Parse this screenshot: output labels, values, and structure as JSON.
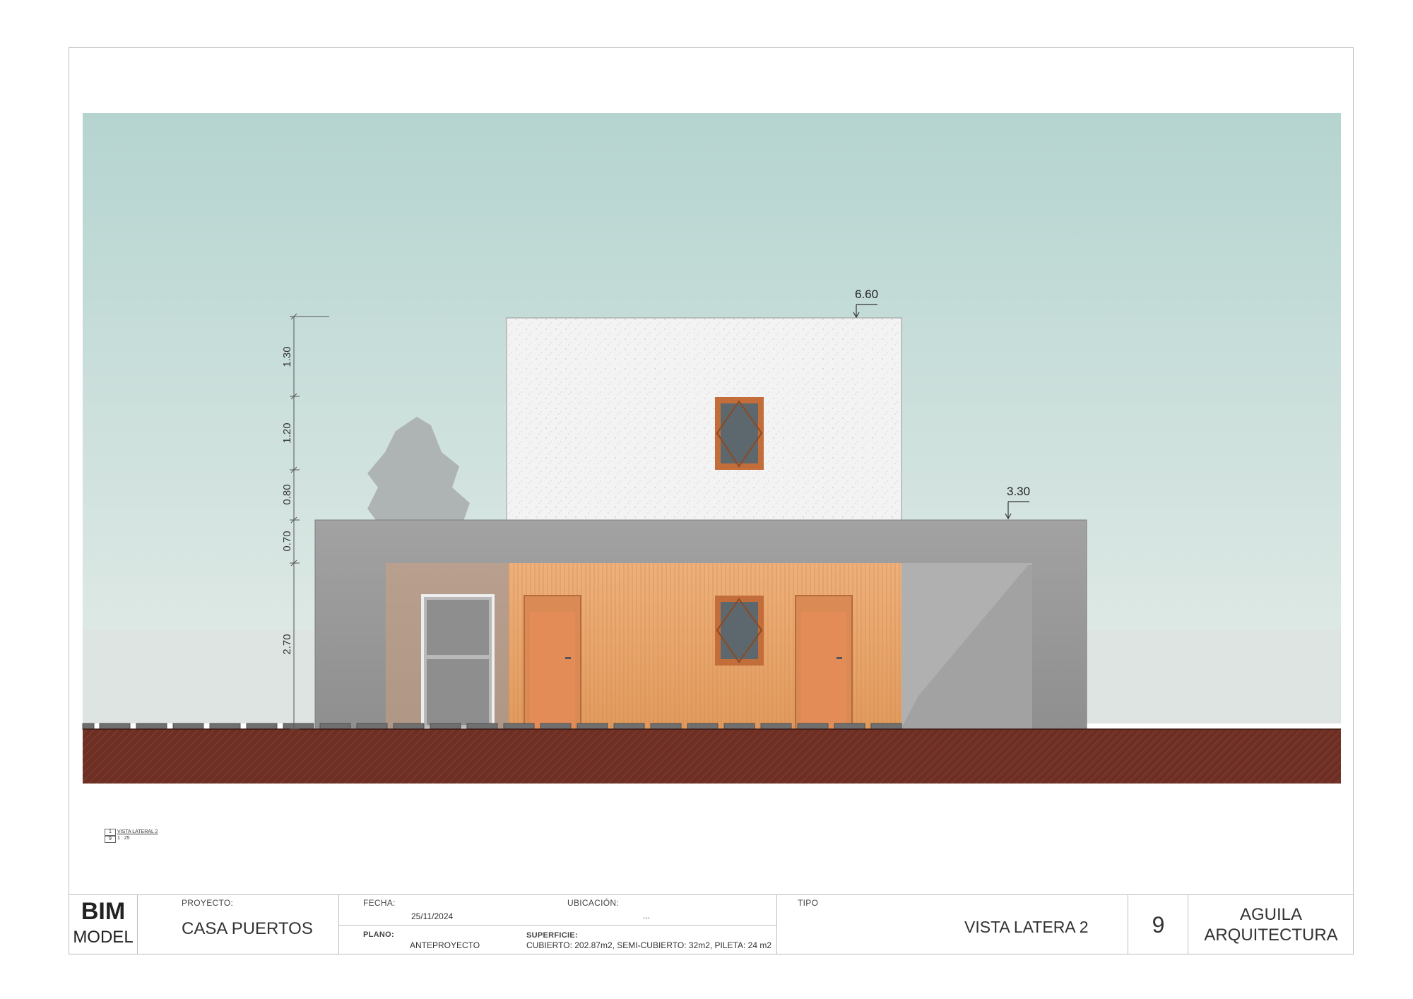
{
  "drawing": {
    "dimensions_vertical": [
      "1.30",
      "1.20",
      "0.80",
      "0.70",
      "2.70"
    ],
    "level_upper": "6.60",
    "level_lower": "3.30",
    "colors": {
      "sky_top": "#b7d5d1",
      "sky_bottom": "#e2ebe7",
      "ground": "#6b2d22",
      "concrete": "#9d9d9d",
      "wood_cladding": "#e9a66d",
      "stucco": "#f2f2f2",
      "window_frame": "#c7713a",
      "glass": "#5f6a70"
    }
  },
  "view_tag": {
    "number": "1",
    "sheet": "9",
    "title": "VISTA LATERAL 2",
    "scale": "1 : 25"
  },
  "title_block": {
    "logo_top": "BIM",
    "logo_bottom": "MODEL",
    "proyecto_label": "PROYECTO:",
    "proyecto_value": "CASA PUERTOS",
    "fecha_label": "FECHA:",
    "fecha_value": "25/11/2024",
    "ubicacion_label": "UBICACIÓN:",
    "ubicacion_value": "...",
    "plano_label": "PLANO:",
    "plano_value": "ANTEPROYECTO",
    "superficie_label": "SUPERFICIE:",
    "superficie_value": "CUBIERTO: 202.87m2, SEMI-CUBIERTO: 32m2, PILETA: 24 m2",
    "tipo_label": "TIPO",
    "tipo_value": "VISTA LATERA 2",
    "sheet_number": "9",
    "studio_line1": "AGUILA",
    "studio_line2": "ARQUITECTURA"
  }
}
